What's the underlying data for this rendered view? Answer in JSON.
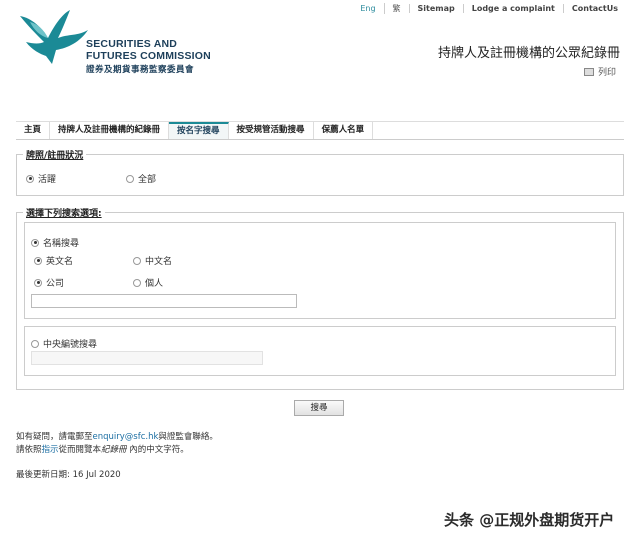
{
  "top_nav": {
    "eng": "Eng",
    "trad": "繁",
    "sitemap": "Sitemap",
    "complaint": "Lodge a complaint",
    "contact": "ContactUs"
  },
  "logo": {
    "line1": "SECURITIES AND",
    "line2": "FUTURES COMMISSION",
    "chinese": "證券及期貨事務監察委員會"
  },
  "page_title": "持牌人及註冊機構的公眾紀錄冊",
  "print_label": "列印",
  "tabs": [
    "主頁",
    "持牌人及註冊機構的紀錄冊",
    "按名字搜尋",
    "按受規管活動搜尋",
    "保薦人名單"
  ],
  "active_tab": "按名字搜尋",
  "status": {
    "legend": "牌照/註冊狀況",
    "active": "活躍",
    "all": "全部",
    "selected": "活躍"
  },
  "search": {
    "legend": "選擇下列搜索選項:",
    "name_search": "名稱搜尋",
    "english_name": "英文名",
    "chinese_name": "中文名",
    "company": "公司",
    "individual": "個人",
    "name_value": "",
    "ce_search": "中央編號搜尋",
    "ce_value": ""
  },
  "search_button": "搜尋",
  "info": {
    "line1_before": "如有疑問，請電郵至",
    "email": "enquiry@sfc.hk",
    "line1_after": "與證監會聯絡。",
    "line2_before": "請依照",
    "guide_link": "指示",
    "line2_middle": "從而閱覽本",
    "register_em": "紀錄冊",
    "line2_after": " 內的中文字符。",
    "last_updated": "最後更新日期: 16 Jul 2020"
  },
  "watermark": "头条 @正规外盘期货开户",
  "colors": {
    "brand_teal": "#1b8a96",
    "logo_navy": "#1d3f5a",
    "link_blue": "#1d6fa3"
  }
}
